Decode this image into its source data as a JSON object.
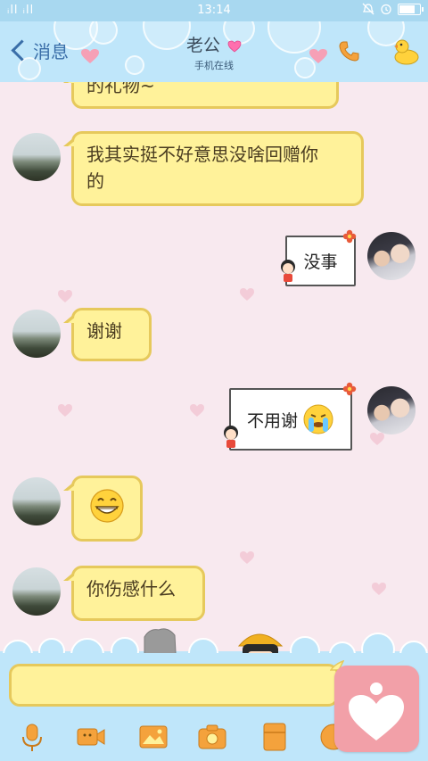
{
  "status_bar": {
    "signal_text": "ᵢll ᵢll",
    "time": "13:14"
  },
  "header": {
    "back_label": "消息",
    "title": "老公",
    "subtitle": "手机在线",
    "icons": [
      "chevron-left-icon",
      "heart-icon",
      "phone-icon",
      "duck-icon"
    ],
    "accent_color": "#3a6ea8",
    "background_color": "#bfe6fa"
  },
  "messages": [
    {
      "side": "left",
      "type": "text",
      "text": "的礼物~"
    },
    {
      "side": "left",
      "type": "text",
      "line1": "我其实挺不好意思没啥回赠你",
      "line2": "的"
    },
    {
      "side": "right",
      "type": "sticker",
      "text": "没事"
    },
    {
      "side": "left",
      "type": "text",
      "text": "谢谢"
    },
    {
      "side": "right",
      "type": "sticker",
      "text": "不用谢"
    },
    {
      "side": "left",
      "type": "emoji",
      "emoji": "grinning-face"
    },
    {
      "side": "left",
      "type": "text",
      "text": "你伤感什么"
    }
  ],
  "input": {
    "value": "",
    "placeholder": ""
  },
  "toolbar": {
    "items": [
      "microphone-icon",
      "video-call-icon",
      "picture-icon",
      "camera-icon",
      "file-icon",
      "emoji-icon"
    ]
  },
  "fab": {
    "icon": "heart-person-icon",
    "color": "#f2a0a8"
  },
  "colors": {
    "bubble_fill": "#fff29a",
    "bubble_border": "#e6c95c",
    "chat_background": "#f8e9ef"
  }
}
